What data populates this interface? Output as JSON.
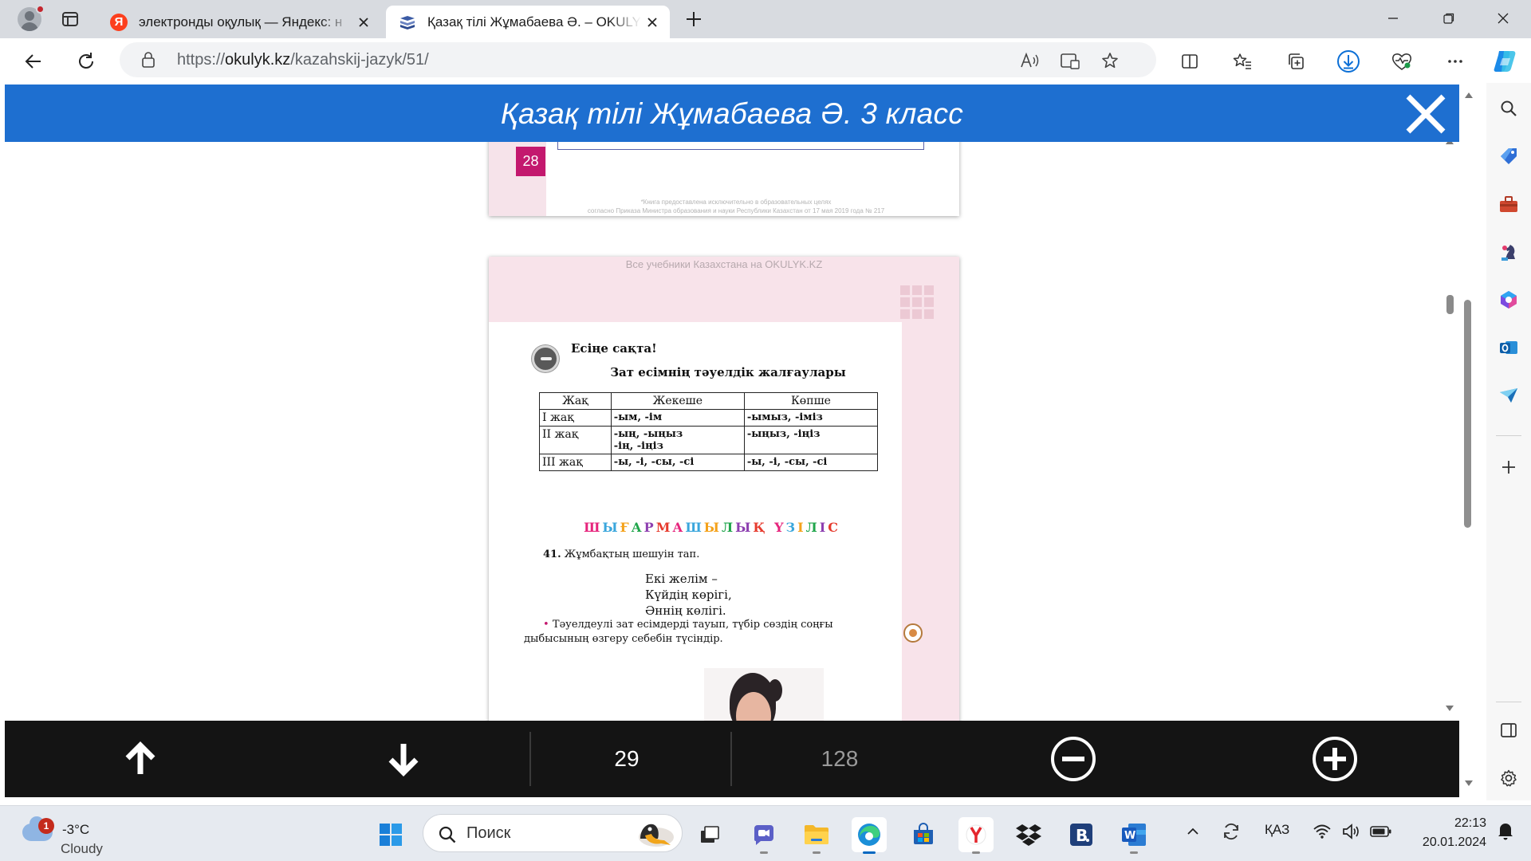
{
  "browser": {
    "tabs": [
      {
        "favicon": "yandex-icon",
        "title": "электронды оқулық — Яндекс: н"
      },
      {
        "favicon": "books-icon",
        "title": "Қазақ тілі Жұмабаева Ә. – OKULYK"
      }
    ],
    "address": {
      "prefix": "https://",
      "host": "okulyk.kz",
      "path": "/kazahskij-jazyk/51/"
    }
  },
  "viewer": {
    "title": "Қазақ тілі Жұмабаева Ә. 3 класс",
    "prev_page": {
      "number": "28",
      "footnote_1": "*Книга предоставлена исключительно в образовательных целях",
      "footnote_2": "согласно Приказа Министра образования и науки Республики Казахстан от 17 мая 2019 года № 217"
    },
    "page": {
      "watermark": "Все учебники Казахстана на OKULYK.KZ",
      "remember": "Есіңе сақта!",
      "table_title": "Зат есімнің тәуелдік жалғаулары",
      "table": {
        "headers": [
          "Жақ",
          "Жекеше",
          "Көпше"
        ],
        "rows": [
          [
            "I жақ",
            "-ым, -ім",
            "-ымыз, -іміз"
          ],
          [
            "II жақ",
            "-ың, -ыңыз\n-ің, -іңіз",
            "-ыңыз, -іңіз"
          ],
          [
            "III жақ",
            "-ы, -і, -сы, -сі",
            "-ы, -і, -сы, -сі"
          ]
        ]
      },
      "creative_heading": "ШЫҒАРМАШЫЛЫҚ ҮЗІЛІС",
      "creative_colors": [
        "#e6247c",
        "#3aa6dc",
        "#f4a21b",
        "#1fa54b",
        "#8d3fb0",
        "#e63b2e"
      ],
      "task_number": "41.",
      "task_text": "Жұмбақтың шешуін тап.",
      "riddle": [
        "Екі желім –",
        "Күйдің көрігі,",
        "Әннің көлігі."
      ],
      "instruction": "Тәуелдеулі зат есімдерді тауып, түбір сөздің соңғы дыбысының өзгеру себебін түсіндір."
    },
    "nav": {
      "current_page": "29",
      "total_pages": "128"
    }
  },
  "taskbar": {
    "weather": {
      "badge": "1",
      "temp": "-3°C",
      "condition": "Cloudy"
    },
    "search_placeholder": "Поиск",
    "language": "ҚАЗ",
    "time": "22:13",
    "date": "20.01.2024"
  },
  "colors": {
    "header_blue": "#1e6fd0",
    "page_pink": "#f8e3ea",
    "page_number_magenta": "#c3186e",
    "nav_bar": "#141414"
  }
}
